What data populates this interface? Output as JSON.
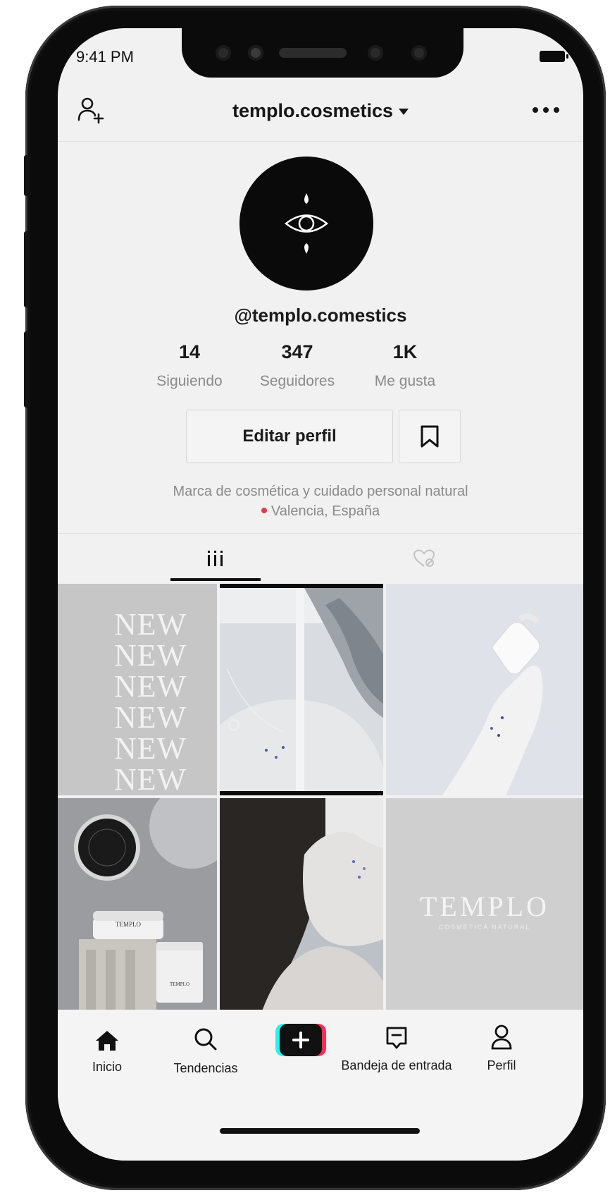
{
  "status_bar": {
    "time": "9:41 PM"
  },
  "header": {
    "title": "templo.cosmetics"
  },
  "profile": {
    "username": "@templo.comestics",
    "stats": [
      {
        "value": "14",
        "label": "Siguiendo"
      },
      {
        "value": "347",
        "label": "Seguidores"
      },
      {
        "value": "1K",
        "label": "Me gusta"
      }
    ],
    "edit_button": "Editar perfil",
    "bio": "Marca de cosmética y cuidado personal natural",
    "location": "Valencia, España"
  },
  "tabs": [
    {
      "icon": "grid-icon",
      "selected": true
    },
    {
      "icon": "liked-hidden-icon",
      "selected": false
    }
  ],
  "grid": {
    "new_text": [
      "NEW",
      "NEW",
      "NEW",
      "NEW",
      "NEW",
      "NEW"
    ],
    "templo_title": "TEMPLO",
    "templo_subtitle": "COSMÉTICA NATURAL",
    "jar_label_1": "TEMPLO",
    "jar_label_2": "TEMPLO"
  },
  "bottom_nav": [
    {
      "label": "Inicio",
      "icon": "home-icon"
    },
    {
      "label": "Tendencias",
      "icon": "search-icon"
    },
    {
      "label": "",
      "icon": "plus-icon"
    },
    {
      "label": "Bandeja de entrada",
      "icon": "inbox-icon"
    },
    {
      "label": "Perfil",
      "icon": "profile-icon"
    }
  ],
  "colors": {
    "screen_bg": "#f1f1f1",
    "accent_cyan": "#25f4ee",
    "accent_red": "#fe2c55",
    "text_secondary": "#8a8a8a"
  }
}
